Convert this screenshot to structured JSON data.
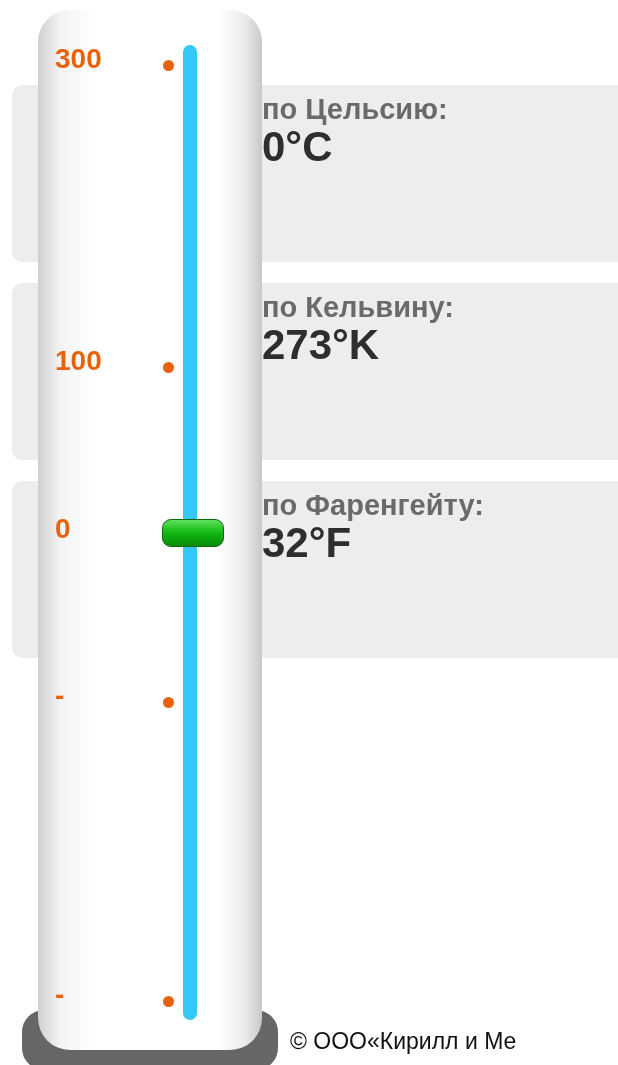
{
  "scale": {
    "ticks": [
      {
        "label": "300"
      },
      {
        "label": "100"
      },
      {
        "label": "0"
      },
      {
        "label": "-"
      },
      {
        "label": "-"
      }
    ],
    "level": 0.5
  },
  "readings": [
    {
      "label": "по Цельсию:",
      "value": "0°C"
    },
    {
      "label": "по Кельвину:",
      "value": "273°K"
    },
    {
      "label": "по Фаренгейту:",
      "value": "32°F"
    }
  ],
  "footer": "© ООО«Кирилл и Ме"
}
